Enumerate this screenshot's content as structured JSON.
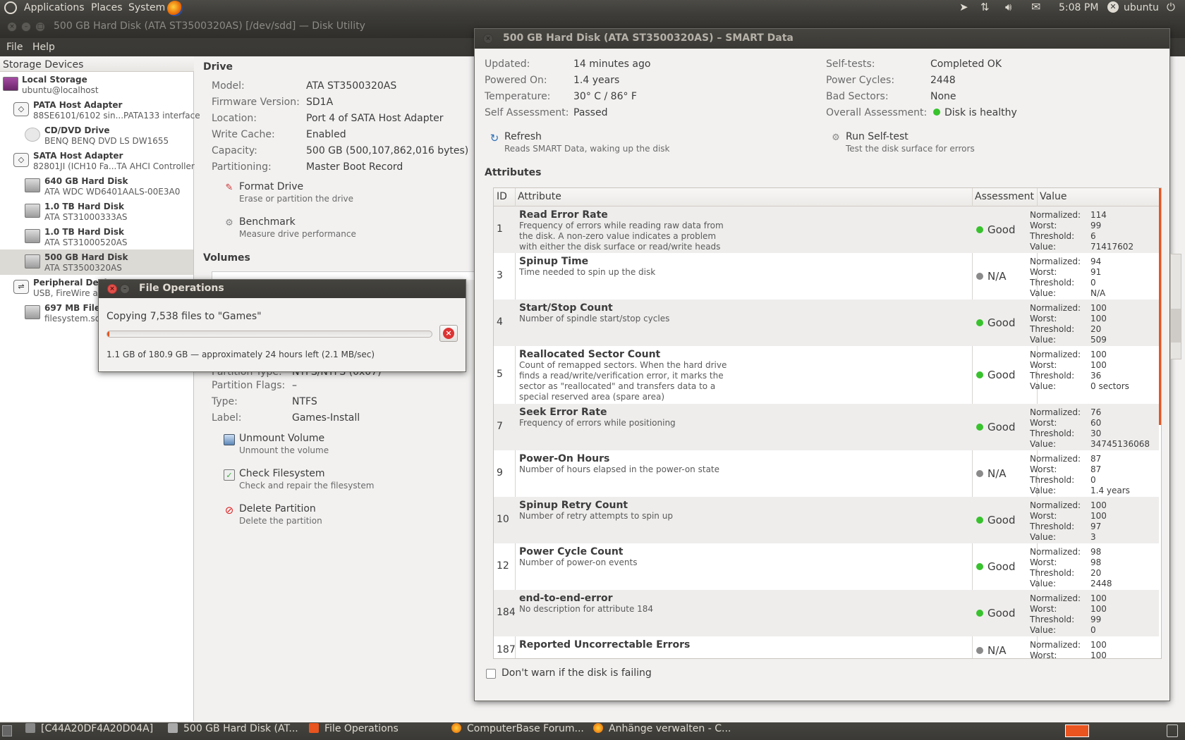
{
  "top_panel": {
    "menus": [
      "Applications",
      "Places",
      "System"
    ],
    "time": "5:08 PM",
    "user": "ubuntu"
  },
  "main_window": {
    "title": "500 GB Hard Disk (ATA ST3500320AS) [/dev/sdd] — Disk Utility",
    "menu": [
      "File",
      "Help"
    ]
  },
  "sidebar": {
    "header": "Storage Devices",
    "items": [
      {
        "title": "Local Storage",
        "sub": "ubuntu@localhost"
      },
      {
        "title": "PATA Host Adapter",
        "sub": "88SE6101/6102 sin...PATA133 interface"
      },
      {
        "title": "CD/DVD Drive",
        "sub": "BENQ BENQ     DVD LS DW1655"
      },
      {
        "title": "SATA Host Adapter",
        "sub": "82801JI (ICH10 Fa...TA AHCI Controller"
      },
      {
        "title": "640 GB Hard Disk",
        "sub": "ATA WDC WD6401AALS-00E3A0"
      },
      {
        "title": "1.0 TB Hard Disk",
        "sub": "ATA ST31000333AS"
      },
      {
        "title": "1.0 TB Hard Disk",
        "sub": "ATA ST31000520AS"
      },
      {
        "title": "500 GB Hard Disk",
        "sub": "ATA ST3500320AS"
      },
      {
        "title": "Peripheral Devi",
        "sub": "USB, FireWire an"
      },
      {
        "title": "697 MB File",
        "sub": "filesystem.squ"
      }
    ]
  },
  "drive": {
    "heading": "Drive",
    "fields": [
      {
        "label": "Model:",
        "value": "ATA ST3500320AS"
      },
      {
        "label": "Firmware Version:",
        "value": "SD1A"
      },
      {
        "label": "Location:",
        "value": "Port 4 of SATA Host Adapter"
      },
      {
        "label": "Write Cache:",
        "value": "Enabled"
      },
      {
        "label": "Capacity:",
        "value": "500 GB (500,107,862,016 bytes)"
      },
      {
        "label": "Partitioning:",
        "value": "Master Boot Record"
      }
    ],
    "actions": [
      {
        "name": "Format Drive",
        "desc": "Erase or partition the drive"
      },
      {
        "name": "Benchmark",
        "desc": "Measure drive performance"
      }
    ]
  },
  "volumes": {
    "heading": "Volumes",
    "partial_row": "Partition Type:",
    "partial_value": "NTFS/NTFS (0x07)",
    "fields": [
      {
        "label": "Partition Flags:",
        "value": "–"
      },
      {
        "label": "Type:",
        "value": "NTFS"
      },
      {
        "label": "Label:",
        "value": "Games-Install"
      }
    ],
    "actions": [
      {
        "name": "Unmount Volume",
        "desc": "Unmount the volume"
      },
      {
        "name": "Check Filesystem",
        "desc": "Check and repair the filesystem"
      },
      {
        "name": "Delete Partition",
        "desc": "Delete the partition"
      }
    ]
  },
  "smart": {
    "title": "500 GB Hard Disk (ATA ST3500320AS) – SMART Data",
    "left": [
      {
        "label": "Updated:",
        "value": "14 minutes ago"
      },
      {
        "label": "Powered On:",
        "value": "1.4 years"
      },
      {
        "label": "Temperature:",
        "value": "30° C / 86° F"
      },
      {
        "label": "Self Assessment:",
        "value": "Passed"
      }
    ],
    "right": [
      {
        "label": "Self-tests:",
        "value": "Completed OK"
      },
      {
        "label": "Power Cycles:",
        "value": "2448"
      },
      {
        "label": "Bad Sectors:",
        "value": "None"
      },
      {
        "label": "Overall Assessment:",
        "value": "Disk is healthy"
      }
    ],
    "refresh": {
      "name": "Refresh",
      "desc": "Reads SMART Data, waking up the disk"
    },
    "selftest": {
      "name": "Run Self-test",
      "desc": "Test the disk surface for errors"
    },
    "attributes_heading": "Attributes",
    "columns": {
      "id": "ID",
      "attribute": "Attribute",
      "assessment": "Assessment",
      "value": "Value"
    },
    "value_labels": {
      "normalized": "Normalized:",
      "worst": "Worst:",
      "threshold": "Threshold:",
      "value": "Value:"
    },
    "rows": [
      {
        "id": "1",
        "name": "Read Error Rate",
        "desc": "Frequency of errors while reading raw data from the disk. A non-zero value indicates a problem with either the disk surface or read/write heads",
        "assessment": "Good",
        "normalized": "114",
        "worst": "99",
        "threshold": "6",
        "value": "71417602"
      },
      {
        "id": "3",
        "name": "Spinup Time",
        "desc": "Time needed to spin up the disk",
        "assessment": "N/A",
        "normalized": "94",
        "worst": "91",
        "threshold": "0",
        "value": "N/A"
      },
      {
        "id": "4",
        "name": "Start/Stop Count",
        "desc": "Number of spindle start/stop cycles",
        "assessment": "Good",
        "normalized": "100",
        "worst": "100",
        "threshold": "20",
        "value": "509"
      },
      {
        "id": "5",
        "name": "Reallocated Sector Count",
        "desc": "Count of remapped sectors. When the hard drive finds a read/write/verification error, it marks the sector as \"reallocated\" and transfers data to a special reserved area (spare area)",
        "assessment": "Good",
        "normalized": "100",
        "worst": "100",
        "threshold": "36",
        "value": "0 sectors"
      },
      {
        "id": "7",
        "name": "Seek Error Rate",
        "desc": "Frequency of errors while positioning",
        "assessment": "Good",
        "normalized": "76",
        "worst": "60",
        "threshold": "30",
        "value": "34745136068"
      },
      {
        "id": "9",
        "name": "Power-On Hours",
        "desc": "Number of hours elapsed in the power-on state",
        "assessment": "N/A",
        "normalized": "87",
        "worst": "87",
        "threshold": "0",
        "value": "1.4 years"
      },
      {
        "id": "10",
        "name": "Spinup Retry Count",
        "desc": "Number of retry attempts to spin up",
        "assessment": "Good",
        "normalized": "100",
        "worst": "100",
        "threshold": "97",
        "value": "3"
      },
      {
        "id": "12",
        "name": "Power Cycle Count",
        "desc": "Number of power-on events",
        "assessment": "Good",
        "normalized": "98",
        "worst": "98",
        "threshold": "20",
        "value": "2448"
      },
      {
        "id": "184",
        "name": "end-to-end-error",
        "desc": "No description for attribute 184",
        "assessment": "Good",
        "normalized": "100",
        "worst": "100",
        "threshold": "99",
        "value": "0"
      },
      {
        "id": "187",
        "name": "Reported Uncorrectable Errors",
        "desc": "",
        "assessment": "N/A",
        "normalized": "100",
        "worst": "100",
        "threshold": "",
        "value": ""
      }
    ],
    "dont_warn": "Don't warn if the disk is failing"
  },
  "file_ops": {
    "title": "File Operations",
    "message": "Copying 7,538 files to \"Games\"",
    "progress": 0.006,
    "status": "1.1 GB of 180.9 GB — approximately 24 hours left (2.1 MB/sec)"
  },
  "taskbar": {
    "items": [
      "[C44A20DF4A20D04A]",
      "500 GB Hard Disk (AT...",
      "File Operations",
      "ComputerBase Forum...",
      "Anhänge verwalten - C..."
    ]
  },
  "colors": {
    "accent": "#e9541f",
    "good": "#38c22d",
    "na": "#8a8a8a",
    "panel": "#3c3b37"
  }
}
